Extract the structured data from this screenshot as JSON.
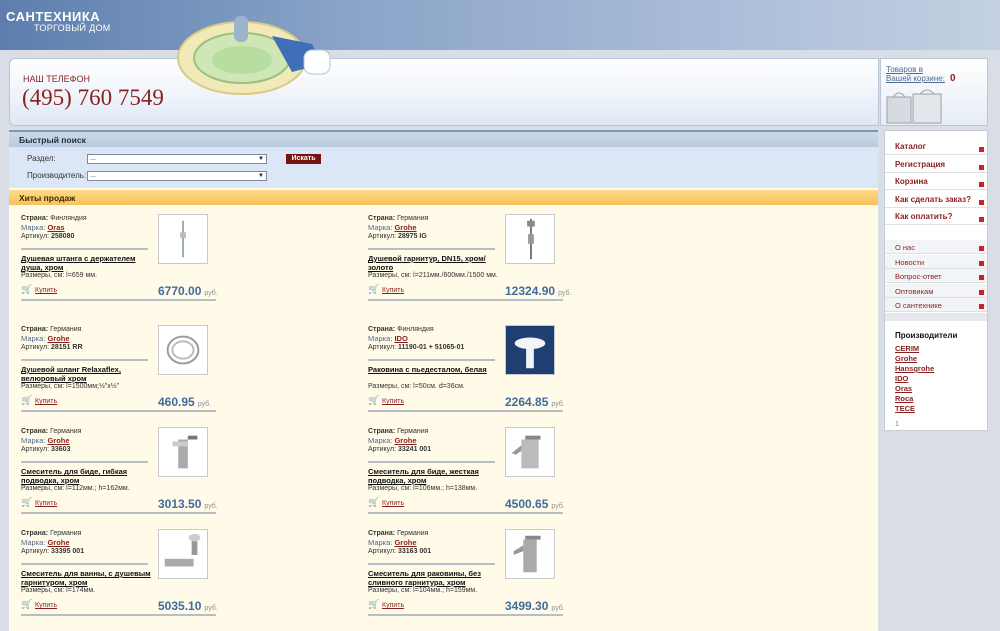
{
  "logo": {
    "line1": "САНТЕХНИКА",
    "line2": "ТОРГОВЫЙ ДОМ"
  },
  "header": {
    "phone_label": "НАШ ТЕЛЕФОН",
    "phone": "(495) 760 7549"
  },
  "cart": {
    "link_line1": "Товаров в",
    "link_line2": "Вашей корзине:",
    "count": "0"
  },
  "search": {
    "title": "Быстрый поиск",
    "section_label": "Раздел:",
    "section_value": "...",
    "maker_label": "Производитель:",
    "maker_value": "...",
    "button": "Искать"
  },
  "hits_title": "Хиты продаж",
  "labels": {
    "country": "Страна:",
    "brand": "Марка:",
    "article": "Артикул:",
    "buy": "Купить",
    "currency": "руб."
  },
  "products": [
    {
      "country": "Финляндия",
      "brand": "Oras",
      "article": "258080",
      "name": "Душевая штанга с держателем душа, хром",
      "size": "Размеры, см: l=659 мм.",
      "price": "6770.00",
      "icon": "shower-bar-image"
    },
    {
      "country": "Германия",
      "brand": "Grohe",
      "article": "28975 IG",
      "name": "Душевой гарнитур, DN15, хром/золото",
      "size": "Размеры, см: l=211мм./600мм./1500 мм.",
      "price": "12324.90",
      "icon": "shower-set-image"
    },
    {
      "country": "Германия",
      "brand": "Grohe",
      "article": "28151 RR",
      "name": "Душевой шланг Relaxaflex, велюровый хром",
      "size": "Размеры, см: l=1500мм;½\"x½\"",
      "price": "460.95",
      "icon": "shower-hose-image"
    },
    {
      "country": "Финляндия",
      "brand": "IDO",
      "article": "11190-01 + 51065-01",
      "name": "Раковина с пьедесталом, белая",
      "size": "Размеры, см: l=50см. d=36см.",
      "price": "2264.85",
      "icon": "washbasin-image"
    },
    {
      "country": "Германия",
      "brand": "Grohe",
      "article": "33603",
      "name": "Смеситель для биде, гибкая подводка, хром",
      "size": "Размеры, см: l=112мм.; h=162мм.",
      "price": "3013.50",
      "icon": "bidet-mixer-image"
    },
    {
      "country": "Германия",
      "brand": "Grohe",
      "article": "33241 001",
      "name": "Смеситель для биде, жесткая подводка, хром",
      "size": "Размеры, см: l=106мм.; h=138мм.",
      "price": "4500.65",
      "icon": "bidet-mixer-image"
    },
    {
      "country": "Германия",
      "brand": "Grohe",
      "article": "33395 001",
      "name": "Смеситель для ванны, с душевым гарнитуром, хром",
      "size": "Размеры, см: l=174мм.",
      "price": "5035.10",
      "icon": "bath-mixer-image"
    },
    {
      "country": "Германия",
      "brand": "Grohe",
      "article": "33163 001",
      "name": "Смеситель для раковины, без сливного гарнитура, хром",
      "size": "Размеры, см: l=104мм.; h=159мм.",
      "price": "3499.30",
      "icon": "basin-mixer-image"
    }
  ],
  "menu_main": [
    "Каталог",
    "Регистрация",
    "Корзина",
    "Как сделать заказ?",
    "Как оплатить?"
  ],
  "menu_secondary": [
    "О нас",
    "Новости",
    "Вопрос-ответ",
    "Оптовикам",
    "О сантехнике"
  ],
  "manufacturers_title": "Производители",
  "manufacturers": [
    "CERIM",
    "Grohe",
    "Hansgrohe",
    "IDO",
    "Oras",
    "Roca",
    "TECE"
  ],
  "page_number": "1"
}
